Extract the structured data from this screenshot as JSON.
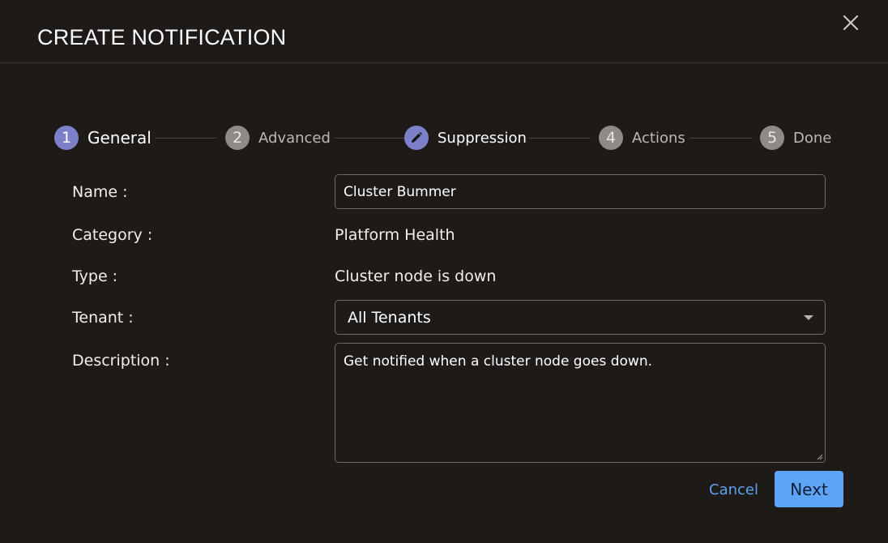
{
  "dialog": {
    "title": "CREATE NOTIFICATION",
    "close_icon": "close-icon"
  },
  "stepper": {
    "steps": [
      {
        "number": "1",
        "label": "General",
        "state": "current"
      },
      {
        "number": "2",
        "label": "Advanced",
        "state": "upcoming"
      },
      {
        "number": "",
        "label": "Suppression",
        "state": "editing",
        "icon": "pencil-icon"
      },
      {
        "number": "4",
        "label": "Actions",
        "state": "upcoming"
      },
      {
        "number": "5",
        "label": "Done",
        "state": "upcoming"
      }
    ],
    "active_color": "#7b80c9",
    "inactive_color": "#8d8a87"
  },
  "form": {
    "name_label": "Name :",
    "name_value": "Cluster Bummer",
    "category_label": "Category :",
    "category_value": "Platform Health",
    "type_label": "Type :",
    "type_value": "Cluster node is down",
    "tenant_label": "Tenant :",
    "tenant_value": "All Tenants",
    "description_label": "Description :",
    "description_value": "Get notified when a cluster node goes down."
  },
  "actions": {
    "cancel_label": "Cancel",
    "next_label": "Next",
    "primary_color": "#5ea4f6"
  }
}
